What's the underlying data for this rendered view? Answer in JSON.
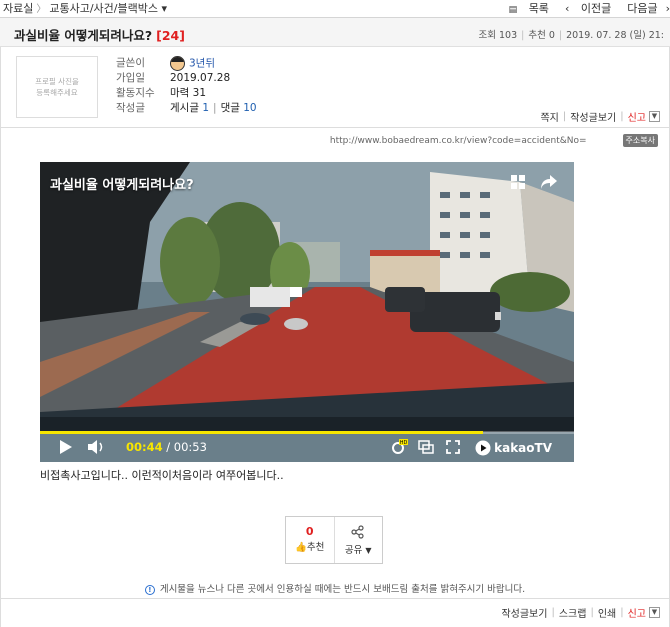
{
  "breadcrumb": {
    "root": "자료실",
    "section": "교통사고/사건/블랙박스",
    "caret": "▾"
  },
  "topnav": {
    "list": "목록",
    "prev": "이전글",
    "next": "다음글"
  },
  "post": {
    "title": "과실비율 어떻게되려나요?",
    "comment_count": "[24]",
    "views": "조회 103",
    "recommends": "추천 0",
    "date": "2019. 07. 28 (일) 21:"
  },
  "author": {
    "profile_placeholder_line1": "프로필 사진을",
    "profile_placeholder_line2": "등록해주세요",
    "label_writer": "글쓴이",
    "nickname": "3년뒤",
    "label_joined": "가입일",
    "joined": "2019.07.28",
    "label_activity": "활동지수",
    "activity": "마력 31",
    "label_posts": "작성글",
    "posts_label": "게시글",
    "posts_count": "1",
    "comments_label": "댓글",
    "comments_count": "10"
  },
  "side_links": {
    "message": "쪽지",
    "view_posts": "작성글보기",
    "report": "신고"
  },
  "url": {
    "text": "http://www.bobaedream.co.kr/view?code=accident&No=",
    "copy": "주소복사"
  },
  "video": {
    "title": "과실비율 어떻게되려나요?",
    "current_time": "00:44",
    "total_time": "/ 00:53",
    "progress": 0.83,
    "brand": "kakaoTV",
    "hd_badge": "HD"
  },
  "body_text": "비접촉사고입니다.. 이런적이처음이라 여쭈어봅니다..",
  "recommend": {
    "count": "0",
    "label": "추천",
    "share": "공유"
  },
  "notice": "게시물을 뉴스나 다른 곳에서 인용하실 때에는 반드시 보배드림 출처를 밝혀주시기 바랍니다.",
  "bottom_links": {
    "view_posts": "작성글보기",
    "scrap": "스크랩",
    "print": "인쇄",
    "report": "신고"
  },
  "colors": {
    "accent_red": "#e02020",
    "link_blue": "#2060b0",
    "progress": "#f7e600"
  }
}
